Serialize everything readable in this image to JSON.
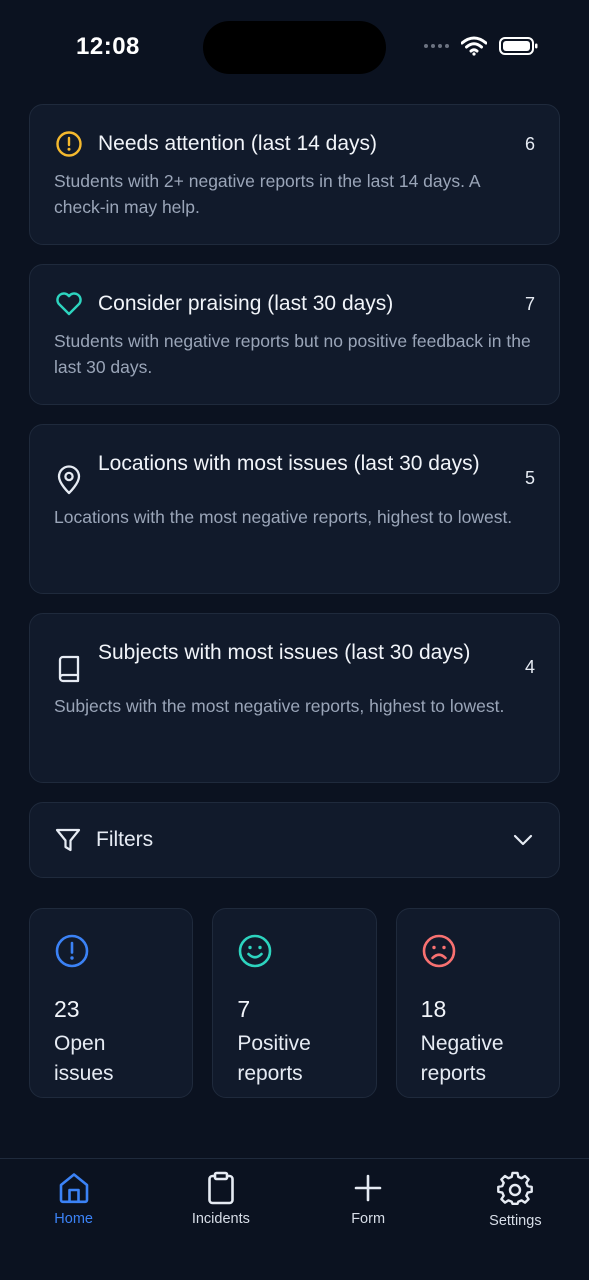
{
  "status_bar": {
    "time": "12:08"
  },
  "insights": [
    {
      "icon": "alert-circle-icon",
      "title": "Needs attention (last 14 days)",
      "count": "6",
      "description": "Students with 2+ negative reports in the last 14 days. A check-in may help.",
      "icon_color": "#f5b92e"
    },
    {
      "icon": "heart-icon",
      "title": "Consider praising (last 30 days)",
      "count": "7",
      "description": "Students with negative reports but no positive feedback in the last 30 days.",
      "icon_color": "#2dd4bf"
    },
    {
      "icon": "map-pin-icon",
      "title": "Locations with most issues (last 30 days)",
      "count": "5",
      "description": "Locations with the most negative reports, highest to lowest.",
      "icon_color": "#e6ebf3"
    },
    {
      "icon": "book-icon",
      "title": "Subjects with most issues (last 30 days)",
      "count": "4",
      "description": "Subjects with the most negative reports, highest to lowest.",
      "icon_color": "#e6ebf3"
    }
  ],
  "filters": {
    "label": "Filters"
  },
  "stats": [
    {
      "icon": "alert-circle-icon",
      "value": "23",
      "label": "Open issues",
      "color": "#3b82f6"
    },
    {
      "icon": "smile-icon",
      "value": "7",
      "label": "Positive reports",
      "color": "#2dd4bf"
    },
    {
      "icon": "frown-icon",
      "value": "18",
      "label": "Negative reports",
      "color": "#f87171"
    }
  ],
  "tabbar": {
    "items": [
      {
        "icon": "home-icon",
        "label": "Home",
        "active": true
      },
      {
        "icon": "clipboard-icon",
        "label": "Incidents",
        "active": false
      },
      {
        "icon": "plus-icon",
        "label": "Form",
        "active": false
      },
      {
        "icon": "gear-icon",
        "label": "Settings",
        "active": false
      }
    ],
    "active_color": "#3b82f6"
  }
}
